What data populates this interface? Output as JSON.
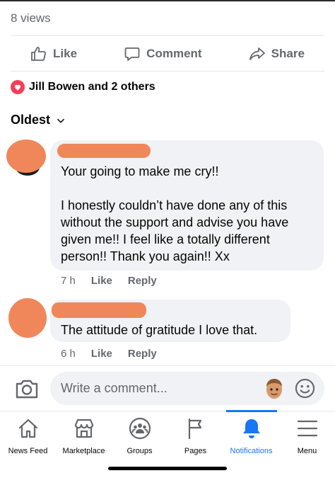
{
  "post": {
    "views": "8 views",
    "actions": {
      "like": "Like",
      "comment": "Comment",
      "share": "Share"
    },
    "reactions_text": "Jill Bowen and 2 others"
  },
  "comments": {
    "sort_label": "Oldest",
    "items": [
      {
        "text": "Your going to make me cry!!\n\nI honestly couldn’t have done any of this without the support and advise you have given me!! I feel like a totally different person!! Thank you again!! Xx",
        "time": "7 h",
        "like": "Like",
        "reply": "Reply"
      },
      {
        "text": "The attitude of gratitude I love that.",
        "time": "6 h",
        "like": "Like",
        "reply": "Reply"
      }
    ]
  },
  "composer": {
    "placeholder": "Write a comment..."
  },
  "nav": {
    "items": [
      {
        "label": "News Feed",
        "icon": "home-icon"
      },
      {
        "label": "Marketplace",
        "icon": "marketplace-icon"
      },
      {
        "label": "Groups",
        "icon": "groups-icon"
      },
      {
        "label": "Pages",
        "icon": "flag-icon"
      },
      {
        "label": "Notifications",
        "icon": "bell-icon",
        "active": true
      },
      {
        "label": "Menu",
        "icon": "menu-icon"
      }
    ]
  },
  "colors": {
    "accent": "#1877f2",
    "redaction": "#f0875a",
    "bubble": "#f0f2f5",
    "muted": "#65676b",
    "love": "#f33e58"
  }
}
